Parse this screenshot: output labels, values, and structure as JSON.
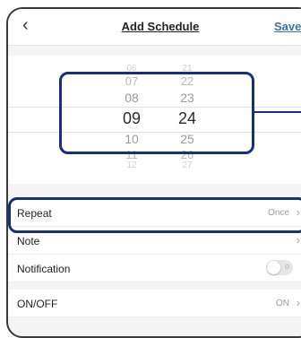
{
  "header": {
    "back_icon": "chevron-left-icon",
    "back_glyph": "‹",
    "title": "Add Schedule",
    "save_label": "Save"
  },
  "picker": {
    "hours": [
      "06",
      "07",
      "08",
      "09",
      "10",
      "11",
      "12"
    ],
    "minutes": [
      "21",
      "22",
      "23",
      "24",
      "25",
      "26",
      "27"
    ],
    "selected_hour": "09",
    "selected_minute": "24"
  },
  "rows": {
    "repeat": {
      "label": "Repeat",
      "value": "Once",
      "chevron": "›"
    },
    "note": {
      "label": "Note",
      "value": "",
      "chevron": "›"
    },
    "notification": {
      "label": "Notification",
      "toggle_on": false
    },
    "onoff": {
      "label": "ON/OFF",
      "value": "ON",
      "chevron": "›"
    }
  },
  "colors": {
    "accent": "#3d6fb3",
    "annotation": "#1a2e7d",
    "background": "#f4f4f4"
  }
}
